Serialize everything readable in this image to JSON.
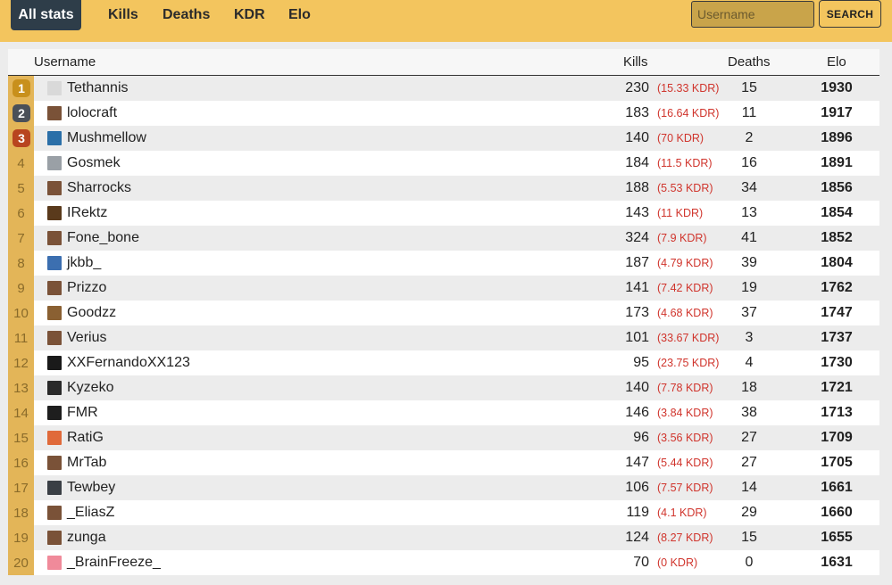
{
  "nav": {
    "tabs": [
      {
        "label": "All stats",
        "active": true
      },
      {
        "label": "Kills"
      },
      {
        "label": "Deaths"
      },
      {
        "label": "KDR"
      },
      {
        "label": "Elo"
      }
    ]
  },
  "search": {
    "placeholder": "Username",
    "value": "",
    "button_label": "SEARCH"
  },
  "table": {
    "headers": {
      "username": "Username",
      "kills": "Kills",
      "deaths": "Deaths",
      "elo": "Elo"
    },
    "medal_colors": [
      "#c8901c",
      "#4a5058",
      "#b8451f"
    ],
    "rows": [
      {
        "rank": "1",
        "username": "Tethannis",
        "kills": "230",
        "kdr": "(15.33 KDR)",
        "deaths": "15",
        "elo": "1930",
        "avatar_color": "#d9d9d9"
      },
      {
        "rank": "2",
        "username": "lolocraft",
        "kills": "183",
        "kdr": "(16.64 KDR)",
        "deaths": "11",
        "elo": "1917",
        "avatar_color": "#7a5238"
      },
      {
        "rank": "3",
        "username": "Mushmellow",
        "kills": "140",
        "kdr": "(70 KDR)",
        "deaths": "2",
        "elo": "1896",
        "avatar_color": "#2b6fa8"
      },
      {
        "rank": "4",
        "username": "Gosmek",
        "kills": "184",
        "kdr": "(11.5 KDR)",
        "deaths": "16",
        "elo": "1891",
        "avatar_color": "#9aa0a6"
      },
      {
        "rank": "5",
        "username": "Sharrocks",
        "kills": "188",
        "kdr": "(5.53 KDR)",
        "deaths": "34",
        "elo": "1856",
        "avatar_color": "#7a5238"
      },
      {
        "rank": "6",
        "username": "IRektz",
        "kills": "143",
        "kdr": "(11 KDR)",
        "deaths": "13",
        "elo": "1854",
        "avatar_color": "#5a3a1c"
      },
      {
        "rank": "7",
        "username": "Fone_bone",
        "kills": "324",
        "kdr": "(7.9 KDR)",
        "deaths": "41",
        "elo": "1852",
        "avatar_color": "#7a5238"
      },
      {
        "rank": "8",
        "username": "jkbb_",
        "kills": "187",
        "kdr": "(4.79 KDR)",
        "deaths": "39",
        "elo": "1804",
        "avatar_color": "#3c6fb0"
      },
      {
        "rank": "9",
        "username": "Prizzo",
        "kills": "141",
        "kdr": "(7.42 KDR)",
        "deaths": "19",
        "elo": "1762",
        "avatar_color": "#7a5238"
      },
      {
        "rank": "10",
        "username": "Goodzz",
        "kills": "173",
        "kdr": "(4.68 KDR)",
        "deaths": "37",
        "elo": "1747",
        "avatar_color": "#8a6032"
      },
      {
        "rank": "11",
        "username": "Verius",
        "kills": "101",
        "kdr": "(33.67 KDR)",
        "deaths": "3",
        "elo": "1737",
        "avatar_color": "#7a5238"
      },
      {
        "rank": "12",
        "username": "XXFernandoXX123",
        "kills": "95",
        "kdr": "(23.75 KDR)",
        "deaths": "4",
        "elo": "1730",
        "avatar_color": "#1a1a1a"
      },
      {
        "rank": "13",
        "username": "Kyzeko",
        "kills": "140",
        "kdr": "(7.78 KDR)",
        "deaths": "18",
        "elo": "1721",
        "avatar_color": "#2a2a2a"
      },
      {
        "rank": "14",
        "username": "FMR",
        "kills": "146",
        "kdr": "(3.84 KDR)",
        "deaths": "38",
        "elo": "1713",
        "avatar_color": "#1e1e1e"
      },
      {
        "rank": "15",
        "username": "RatiG",
        "kills": "96",
        "kdr": "(3.56 KDR)",
        "deaths": "27",
        "elo": "1709",
        "avatar_color": "#e06a3a"
      },
      {
        "rank": "16",
        "username": "MrTab",
        "kills": "147",
        "kdr": "(5.44 KDR)",
        "deaths": "27",
        "elo": "1705",
        "avatar_color": "#7a5238"
      },
      {
        "rank": "17",
        "username": "Tewbey",
        "kills": "106",
        "kdr": "(7.57 KDR)",
        "deaths": "14",
        "elo": "1661",
        "avatar_color": "#3a3f45"
      },
      {
        "rank": "18",
        "username": "_EliasZ",
        "kills": "119",
        "kdr": "(4.1 KDR)",
        "deaths": "29",
        "elo": "1660",
        "avatar_color": "#7a5238"
      },
      {
        "rank": "19",
        "username": "zunga",
        "kills": "124",
        "kdr": "(8.27 KDR)",
        "deaths": "15",
        "elo": "1655",
        "avatar_color": "#7a5238"
      },
      {
        "rank": "20",
        "username": "_BrainFreeze_",
        "kills": "70",
        "kdr": "(0 KDR)",
        "deaths": "0",
        "elo": "1631",
        "avatar_color": "#f08a9a"
      }
    ]
  }
}
